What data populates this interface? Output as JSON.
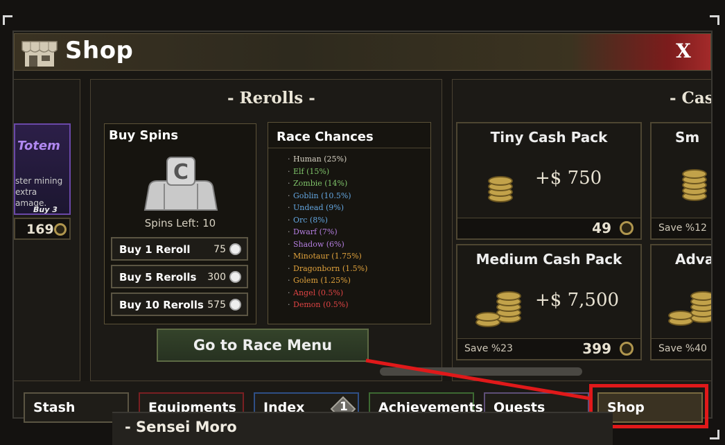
{
  "window": {
    "title": "Shop",
    "close_label": "X"
  },
  "partial_left": {
    "title": "Totem",
    "desc_lines": [
      "ster mining",
      "extra",
      "amage."
    ],
    "badge": "Buy 3",
    "price": "169"
  },
  "rerolls": {
    "header": "- Rerolls -",
    "buy_spins": {
      "title": "Buy Spins",
      "spins_label": "Spins Left: 10",
      "icon_letter": "C"
    },
    "buttons": [
      {
        "label": "Buy 1 Reroll",
        "price": "75"
      },
      {
        "label": "Buy 5 Rerolls",
        "price": "300"
      },
      {
        "label": "Buy 10 Rerolls",
        "price": "575"
      }
    ],
    "race_chances": {
      "title": "Race Chances",
      "items": [
        {
          "text": "Human (25%)",
          "color": "#d9d4c6"
        },
        {
          "text": "Elf (15%)",
          "color": "#7fc46a"
        },
        {
          "text": "Zombie (14%)",
          "color": "#7fc46a"
        },
        {
          "text": "Goblin (10.5%)",
          "color": "#63a6e0"
        },
        {
          "text": "Undead (9%)",
          "color": "#63a6e0"
        },
        {
          "text": "Orc (8%)",
          "color": "#63a6e0"
        },
        {
          "text": "Dwarf (7%)",
          "color": "#b47ee0"
        },
        {
          "text": "Shadow (6%)",
          "color": "#b47ee0"
        },
        {
          "text": "Minotaur (1.75%)",
          "color": "#e0a23c"
        },
        {
          "text": "Dragonborn (1.5%)",
          "color": "#e0a23c"
        },
        {
          "text": "Golem (1.25%)",
          "color": "#e0a23c"
        },
        {
          "text": "Angel (0.5%)",
          "color": "#e04444"
        },
        {
          "text": "Demon (0.5%)",
          "color": "#e04444"
        }
      ]
    },
    "race_menu_button": "Go to Race Menu"
  },
  "cash": {
    "header": "- Cas",
    "packs": [
      {
        "title": "Tiny Cash Pack",
        "amount": "+$ 750",
        "save": "",
        "price": "49"
      },
      {
        "title": "Medium Cash Pack",
        "amount": "+$ 7,500",
        "save": "Save %23",
        "price": "399"
      },
      {
        "title": "Sm",
        "amount": "",
        "save": "Save %12",
        "price": ""
      },
      {
        "title": "Adva",
        "amount": "",
        "save": "Save %40",
        "price": ""
      }
    ]
  },
  "tabs": [
    {
      "label": "Stash"
    },
    {
      "label": "Equipments"
    },
    {
      "label": "Index",
      "badge": "1"
    },
    {
      "label": "Achievements"
    },
    {
      "label": "Quests"
    },
    {
      "label": "Shop"
    }
  ],
  "footer_text": "- Sensei Moro",
  "colors": {
    "highlight": "#e0191a",
    "tab_red": "#7a1f22",
    "tab_blue": "#2f4f86",
    "tab_green": "#3d6a32",
    "tab_purple": "#5e4f78"
  }
}
